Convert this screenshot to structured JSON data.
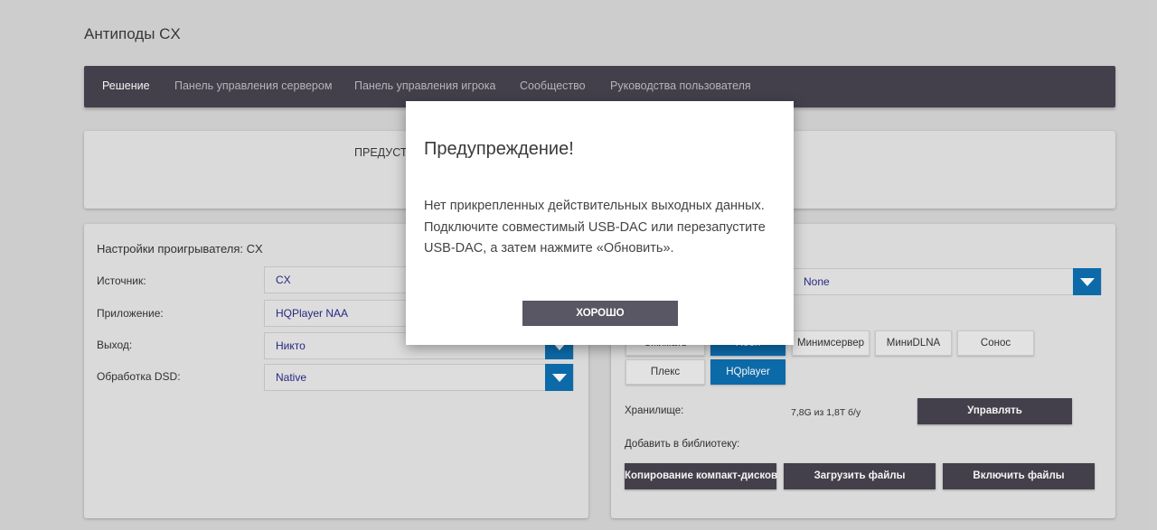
{
  "app": {
    "title": "Антиподы CX"
  },
  "nav": {
    "items": [
      {
        "label": "Решение",
        "active": true
      },
      {
        "label": "Панель управления сервером",
        "active": false
      },
      {
        "label": "Панель управления игрока",
        "active": false
      },
      {
        "label": "Сообщество",
        "active": false
      },
      {
        "label": "Руководства пользователя",
        "active": false
      }
    ]
  },
  "top_card": {
    "notice_fragment": "ПРЕДУСТ"
  },
  "player_settings": {
    "title": "Настройки проигрывателя: CX",
    "rows": [
      {
        "label": "Источник:",
        "value": "CX"
      },
      {
        "label": "Приложение:",
        "value": "HQPlayer NAA"
      },
      {
        "label": "Выход:",
        "value": "Никто"
      },
      {
        "label": "Обработка DSD:",
        "value": "Native"
      }
    ]
  },
  "server_settings": {
    "select_value": "None",
    "apps_row1": [
      {
        "label": "Сжимать",
        "selected": false
      },
      {
        "label": "Roon",
        "selected": true
      },
      {
        "label": "Минимсервер",
        "selected": false
      },
      {
        "label": "МиниDLNA",
        "selected": false
      },
      {
        "label": "Сонос",
        "selected": false
      }
    ],
    "apps_row2": [
      {
        "label": "Плекс",
        "selected": false
      },
      {
        "label": "HQplayer",
        "selected": true
      }
    ],
    "storage_label": "Хранилище:",
    "storage_value": "7,8G из 1,8T б/у",
    "manage_button": "Управлять",
    "add_library_label": "Добавить в библиотеку:",
    "buttons": {
      "copy_cd": "Копирование компакт-дисков",
      "upload": "Загрузить файлы",
      "include": "Включить файлы"
    }
  },
  "modal": {
    "title": "Предупреждение!",
    "message": "Нет прикрепленных действительных выходных данных. Подключите совместимый USB-DAC или перезапустите USB-DAC, а затем нажмите «Обновить».",
    "ok_button": "ХОРОШО"
  },
  "colors": {
    "navbar": "#46434f",
    "accent_blue": "#0d6fb0",
    "dark_button": "#47434f",
    "background": "#d6d6d6"
  }
}
